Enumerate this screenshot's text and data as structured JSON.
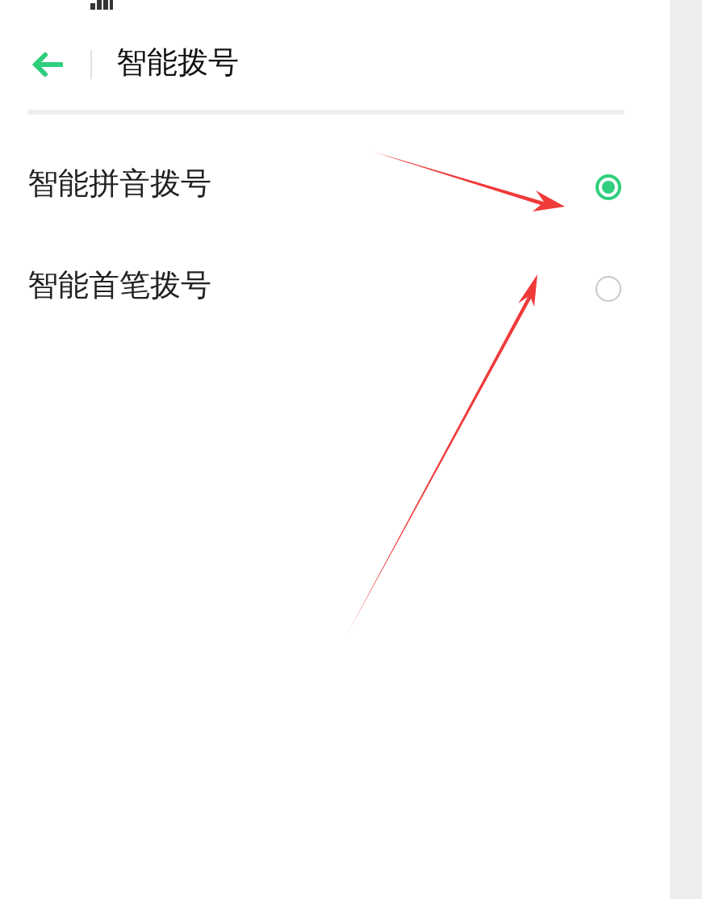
{
  "header": {
    "title": "智能拨号"
  },
  "options": [
    {
      "label": "智能拼音拨号",
      "selected": true
    },
    {
      "label": "智能首笔拨号",
      "selected": false
    }
  ]
}
